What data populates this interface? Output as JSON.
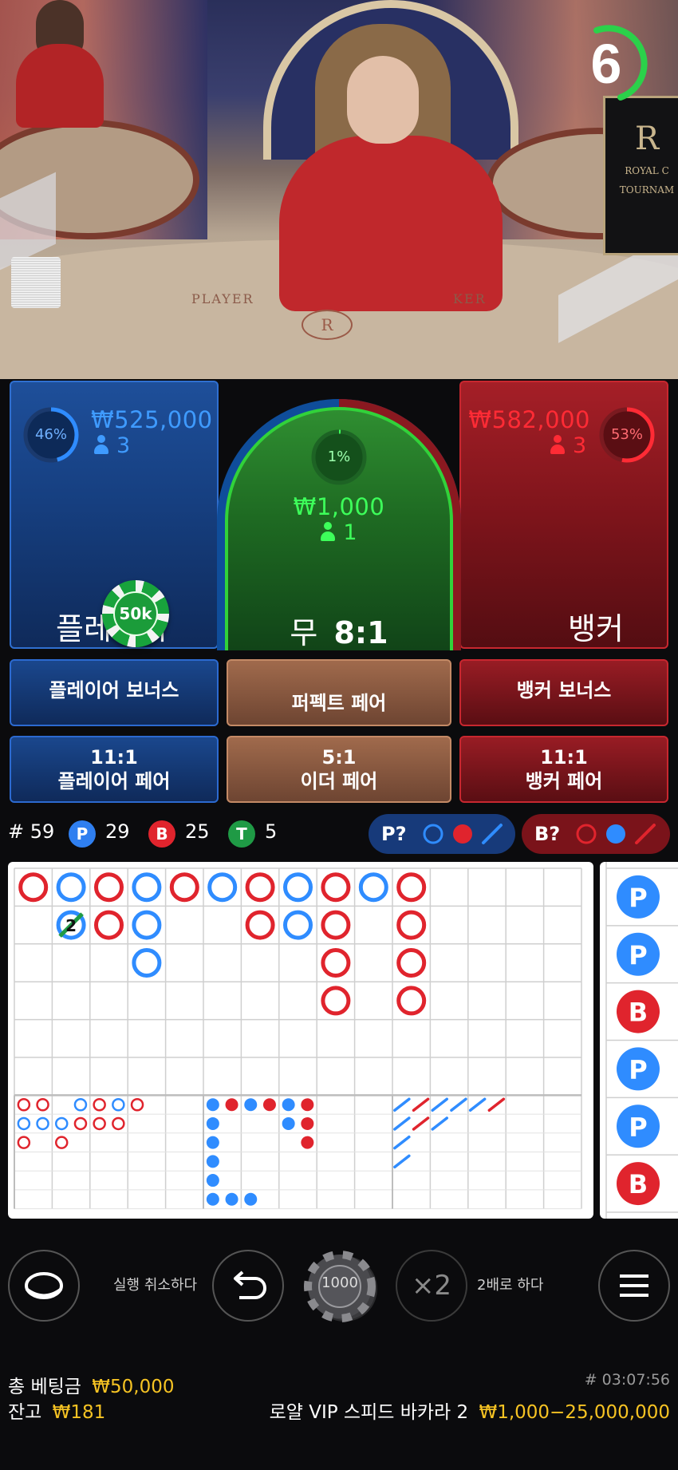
{
  "timer": {
    "seconds": "6",
    "color": "#2bd14a"
  },
  "video": {
    "table_left_text": "PLAYER",
    "table_right_text": "KER",
    "table_logo": "R",
    "sign_letter": "R",
    "sign_line1": "ROYAL C",
    "sign_line2": "TOURNAM"
  },
  "player": {
    "pct": "46%",
    "amount": "₩525,000",
    "count": "3",
    "label": "플레이어",
    "color": "#2f8cff"
  },
  "banker": {
    "pct": "53%",
    "amount": "₩582,000",
    "count": "3",
    "label": "뱅커",
    "color": "#ff2b35"
  },
  "tie": {
    "pct": "1%",
    "amount": "₩1,000",
    "count": "1",
    "label_prefix": "무",
    "label_odds": "8:1",
    "color": "#3dff5a"
  },
  "placed_chip": {
    "value": "50k"
  },
  "bonus_bets": [
    {
      "line1": "",
      "line2": "플레이어 보너스"
    },
    {
      "line1": "",
      "line2": "퍼펙트 페어"
    },
    {
      "line1": "",
      "line2": "뱅커 보너스"
    }
  ],
  "pair_bets": [
    {
      "line1": "11:1",
      "line2": "플레이어 페어"
    },
    {
      "line1": "5:1",
      "line2": "이더 페어"
    },
    {
      "line1": "11:1",
      "line2": "뱅커 페어"
    }
  ],
  "stats": {
    "round_label": "# 59",
    "p_badge": "P",
    "p_count": "29",
    "b_badge": "B",
    "b_count": "25",
    "t_badge": "T",
    "t_count": "5",
    "player_predict": "P?",
    "banker_predict": "B?"
  },
  "big_road": [
    [
      "B",
      "P",
      "B",
      "P",
      "B",
      "P",
      "B",
      "P",
      "B",
      "P",
      "B"
    ],
    [
      "",
      "P",
      "B",
      "P",
      "",
      "",
      "B",
      "P",
      "B",
      "",
      "B"
    ],
    [
      "",
      "",
      "",
      "P",
      "",
      "",
      "",
      "",
      "B",
      "",
      "B"
    ],
    [
      "",
      "",
      "",
      "",
      "",
      "",
      "",
      "",
      "B",
      "",
      "B"
    ]
  ],
  "big_road_tie_marker": "2",
  "bead_road": [
    "P",
    "P",
    "B",
    "P",
    "P",
    "B"
  ],
  "controls": {
    "undo_label": "실행 취소하다",
    "chip_value": "1000",
    "double_symbol": "×2",
    "double_label": "2배로 하다"
  },
  "footer": {
    "total_bet_label": "총 베팅금",
    "total_bet_value": "₩50,000",
    "balance_label": "잔고",
    "balance_value": "₩181",
    "round_time": "# 03:07:56",
    "table_name": "로얄 VIP 스피드 바카라 2",
    "limits": "₩1,000−25,000,000"
  }
}
